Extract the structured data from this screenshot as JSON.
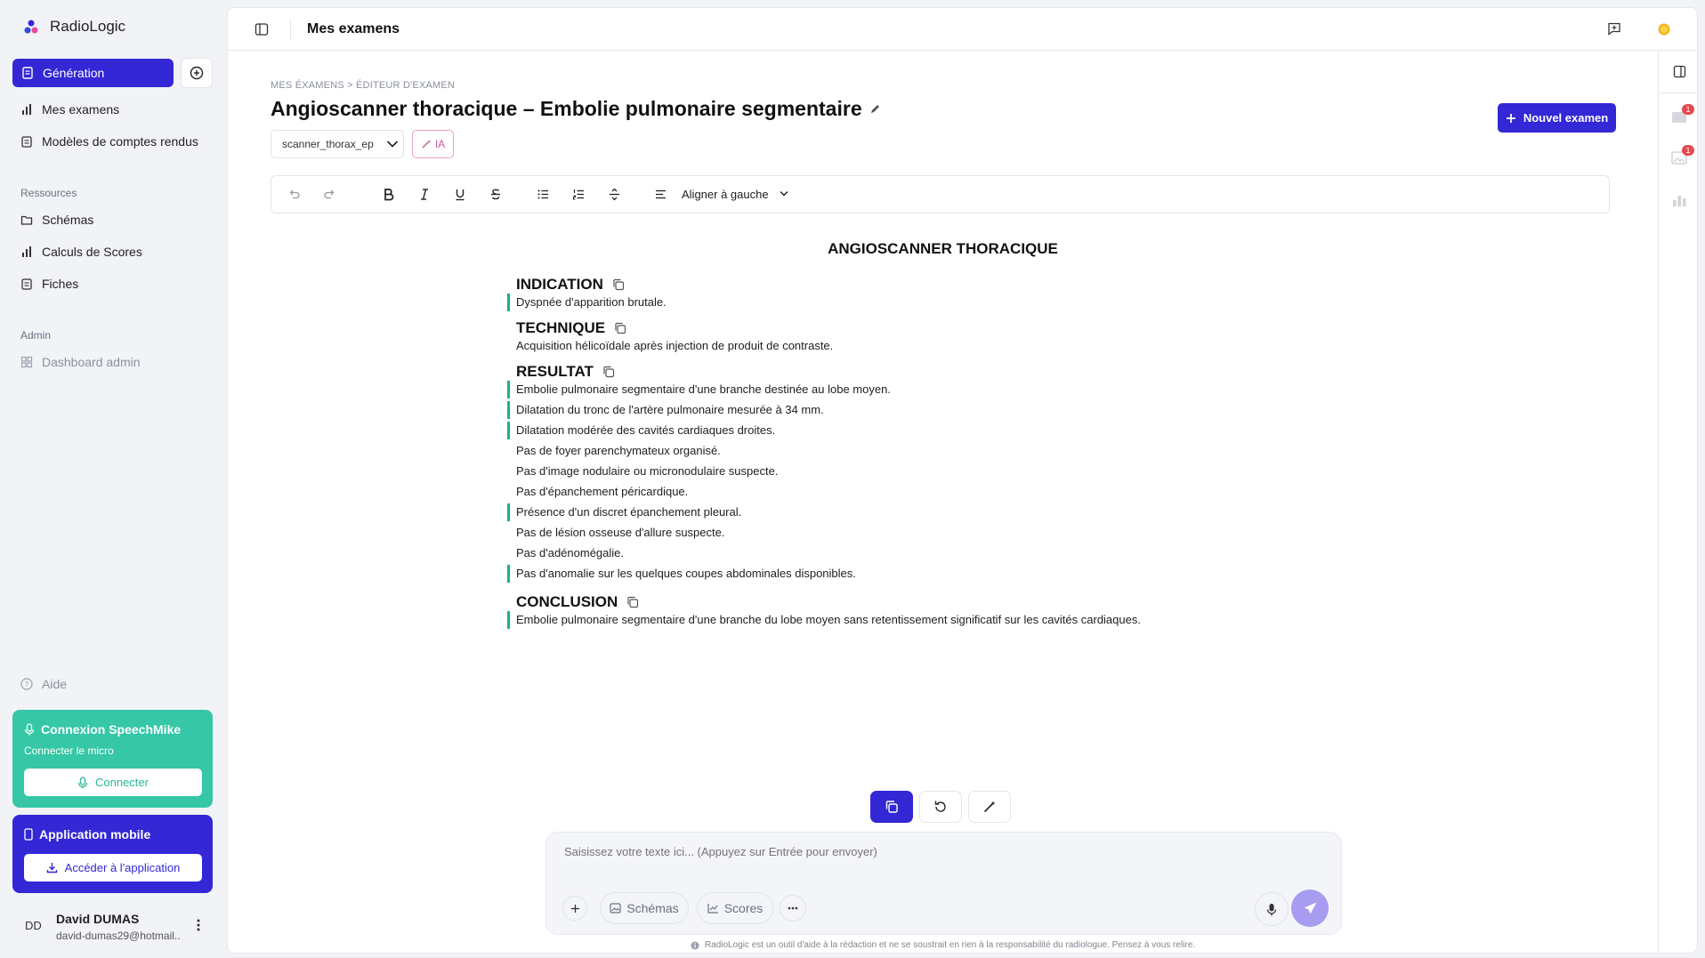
{
  "app": {
    "name": "RadioLogic"
  },
  "sidebar": {
    "generation_label": "Génération",
    "items": [
      {
        "label": "Mes examens",
        "icon": "bar-chart-icon"
      },
      {
        "label": "Modèles de comptes rendus",
        "icon": "clipboard-icon"
      }
    ],
    "resources_label": "Ressources",
    "resources": [
      {
        "label": "Schémas",
        "icon": "folder-icon"
      },
      {
        "label": "Calculs de Scores",
        "icon": "bar-chart-icon"
      },
      {
        "label": "Fiches",
        "icon": "clipboard-icon"
      }
    ],
    "admin_label": "Admin",
    "admin_item": "Dashboard admin",
    "help_label": "Aide",
    "speech": {
      "title": "Connexion SpeechMike",
      "subtitle": "Connecter le micro",
      "button": "Connecter"
    },
    "mobile": {
      "title": "Application mobile",
      "button": "Accéder à l'application"
    },
    "user": {
      "initials": "DD",
      "name": "David DUMAS",
      "email": "david-dumas29@hotmail..."
    }
  },
  "topbar": {
    "title": "Mes examens"
  },
  "exam": {
    "breadcrumb": "MES ÉXAMENS > ÉDITEUR D'EXAMEN",
    "title": "Angioscanner thoracique – Embolie pulmonaire segmentaire",
    "template": "scanner_thorax_ep",
    "ia_label": "IA",
    "new_exam_label": "Nouvel examen"
  },
  "toolbar": {
    "align_label": "Aligner à gauche"
  },
  "document": {
    "title": "ANGIOSCANNER THORACIQUE",
    "sections": {
      "indication": {
        "heading": "INDICATION",
        "lines": [
          "Dyspnée d'apparition brutale."
        ]
      },
      "technique": {
        "heading": "TECHNIQUE",
        "lines": [
          "Acquisition hélicoïdale après injection de produit de contraste."
        ]
      },
      "resultat": {
        "heading": "RESULTAT",
        "lines": [
          "Embolie pulmonaire segmentaire d'une branche destinée au lobe moyen.",
          "Dilatation du tronc de l'artère pulmonaire mesurée à 34 mm.",
          "Dilatation modérée des cavités cardiaques droites.",
          "Pas de foyer parenchymateux organisé.",
          "Pas d'image nodulaire ou micronodulaire suspecte.",
          "Pas d'épanchement péricardique.",
          "Présence d'un discret épanchement pleural.",
          "Pas de lésion osseuse d'allure suspecte.",
          "Pas d'adénomégalie.",
          "Pas d'anomalie sur les quelques coupes abdominales disponibles."
        ]
      },
      "conclusion": {
        "heading": "CONCLUSION",
        "lines": [
          "Embolie pulmonaire segmentaire d'une branche du lobe moyen sans retentissement significatif sur les cavités cardiaques."
        ]
      }
    }
  },
  "composer": {
    "placeholder": "Saisissez votre texte ici... (Appuyez sur Entrée pour envoyer)",
    "chips": {
      "schemas": "Schémas",
      "scores": "Scores"
    }
  },
  "disclaimer": "RadioLogic est un outil d'aide à la rédaction et ne se soustrait en rien à la responsabilité du radiologue. Pensez à vous relire.",
  "rail": {
    "badges": [
      "1",
      "1"
    ]
  },
  "colors": {
    "accent": "#3327d6",
    "speech": "#35c7a6",
    "highlight": "#1db37a"
  }
}
